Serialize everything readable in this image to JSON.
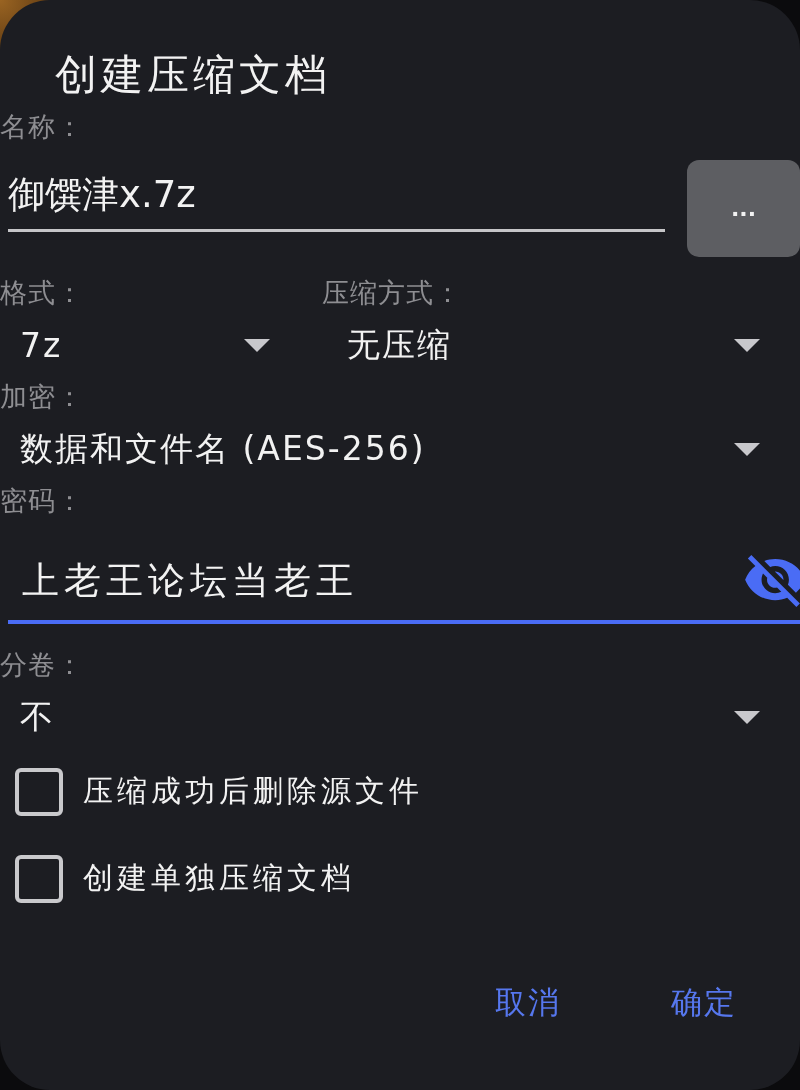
{
  "dialog": {
    "title": "创建压缩文档"
  },
  "name": {
    "label": "名称：",
    "value": "御馔津x.7z",
    "focused": false,
    "browse_button": "..."
  },
  "format": {
    "label": "格式：",
    "value": "7z"
  },
  "compression_method": {
    "label": "压缩方式：",
    "value": "无压缩"
  },
  "encryption": {
    "label": "加密：",
    "value": "数据和文件名 (AES-256)"
  },
  "password": {
    "label": "密码：",
    "value": "上老王论坛当老王",
    "focused": true
  },
  "split_volume": {
    "label": "分卷：",
    "value": "不"
  },
  "options": [
    {
      "label": "压缩成功后删除源文件",
      "checked": false
    },
    {
      "label": "创建单独压缩文档",
      "checked": false
    }
  ],
  "buttons": [
    "取消",
    "确定"
  ]
}
